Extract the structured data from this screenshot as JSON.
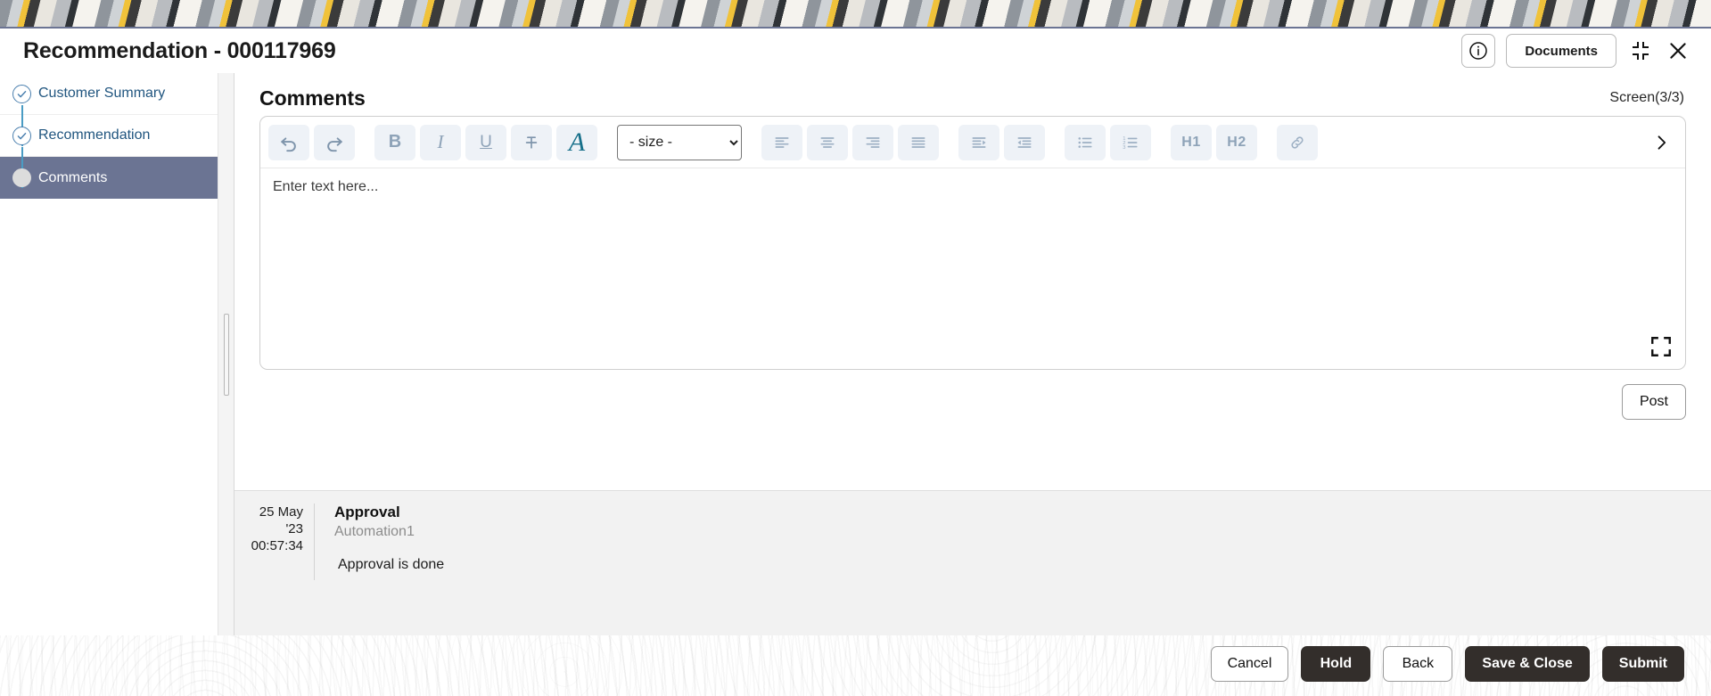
{
  "window": {
    "title": "Recommendation - 000117969",
    "info_icon": "info-circle-icon",
    "documents_label": "Documents",
    "minimize_icon": "collapse-icon",
    "close_icon": "close-icon"
  },
  "sidebar": {
    "items": [
      {
        "label": "Customer Summary",
        "state": "done"
      },
      {
        "label": "Recommendation",
        "state": "done"
      },
      {
        "label": "Comments",
        "state": "active"
      }
    ]
  },
  "main": {
    "section_title": "Comments",
    "screen_counter": "Screen(3/3)"
  },
  "editor": {
    "placeholder": "Enter text here...",
    "size_select_value": "- size -",
    "size_options": [
      "- size -"
    ],
    "expand_icon": "expand-icon",
    "more_icon": "chevron-right-icon",
    "tools": [
      {
        "name": "undo-button",
        "glyph": "↶",
        "label": "undo"
      },
      {
        "name": "redo-button",
        "glyph": "↷",
        "label": "redo"
      },
      {
        "name": "bold-button",
        "glyph": "B",
        "label": "bold"
      },
      {
        "name": "italic-button",
        "glyph": "I",
        "label": "italic"
      },
      {
        "name": "underline-button",
        "glyph": "U",
        "label": "underline"
      },
      {
        "name": "strikethrough-button",
        "glyph": "T̶",
        "label": "strikethrough"
      },
      {
        "name": "text-color-button",
        "glyph": "A",
        "label": "text color"
      },
      {
        "name": "align-left-button",
        "glyph": "",
        "label": "align left"
      },
      {
        "name": "align-center-button",
        "glyph": "",
        "label": "align center"
      },
      {
        "name": "align-right-button",
        "glyph": "",
        "label": "align right"
      },
      {
        "name": "justify-button",
        "glyph": "",
        "label": "justify"
      },
      {
        "name": "indent-button",
        "glyph": "",
        "label": "indent"
      },
      {
        "name": "outdent-button",
        "glyph": "",
        "label": "outdent"
      },
      {
        "name": "bullet-list-button",
        "glyph": "",
        "label": "bulleted list"
      },
      {
        "name": "numbered-list-button",
        "glyph": "",
        "label": "numbered list"
      },
      {
        "name": "heading-1-button",
        "glyph": "H1",
        "label": "heading 1"
      },
      {
        "name": "heading-2-button",
        "glyph": "H2",
        "label": "heading 2"
      },
      {
        "name": "link-button",
        "glyph": "",
        "label": "insert link"
      }
    ],
    "headings": {
      "h1": "H1",
      "h2": "H2"
    }
  },
  "post": {
    "label": "Post"
  },
  "comments": [
    {
      "date": "25 May",
      "year": "'23",
      "time": "00:57:34",
      "title": "Approval",
      "author": "Automation1",
      "body": "Approval is done"
    }
  ],
  "footer": {
    "buttons": [
      {
        "label": "Cancel",
        "style": "outline",
        "name": "cancel-button"
      },
      {
        "label": "Hold",
        "style": "solid",
        "name": "hold-button"
      },
      {
        "label": "Back",
        "style": "outline",
        "name": "back-button"
      },
      {
        "label": "Save & Close",
        "style": "solid",
        "name": "save-and-close-button"
      },
      {
        "label": "Submit",
        "style": "solid",
        "name": "submit-button"
      }
    ]
  },
  "colors": {
    "accent_slate": "#6b7493",
    "link_blue": "#20557f",
    "step_blue": "#4a9cc4",
    "solid_button": "#332e2b",
    "tool_icon": "#8ea3b8",
    "text_color_tool": "#17708a"
  }
}
